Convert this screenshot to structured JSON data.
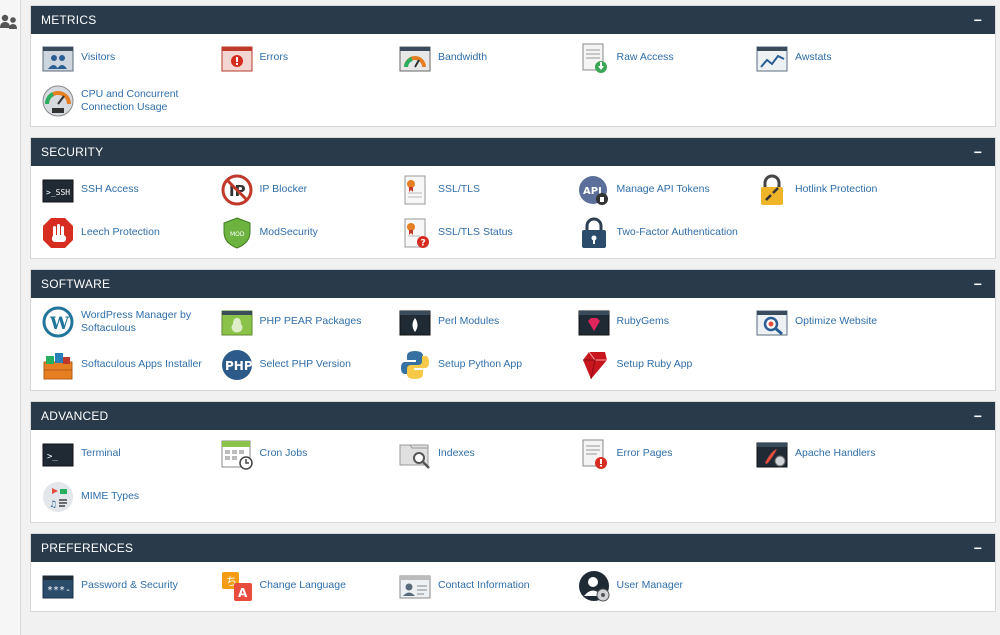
{
  "colors": {
    "header": "#293a4a",
    "link": "#2f6ea9",
    "bg": "#f1f1f1"
  },
  "panels": [
    {
      "title": "METRICS",
      "toggle": "−",
      "items": [
        {
          "label": "Visitors",
          "icon": "visitors-icon"
        },
        {
          "label": "Errors",
          "icon": "errors-icon"
        },
        {
          "label": "Bandwidth",
          "icon": "bandwidth-icon"
        },
        {
          "label": "Raw Access",
          "icon": "raw-access-icon"
        },
        {
          "label": "Awstats",
          "icon": "awstats-icon"
        },
        {
          "label": "CPU and Concurrent Connection Usage",
          "icon": "cpu-usage-icon"
        }
      ]
    },
    {
      "title": "SECURITY",
      "toggle": "−",
      "items": [
        {
          "label": "SSH Access",
          "icon": "ssh-icon"
        },
        {
          "label": "IP Blocker",
          "icon": "ip-blocker-icon"
        },
        {
          "label": "SSL/TLS",
          "icon": "ssl-certificate-icon"
        },
        {
          "label": "Manage API Tokens",
          "icon": "api-tokens-icon"
        },
        {
          "label": "Hotlink Protection",
          "icon": "hotlink-lock-icon"
        },
        {
          "label": "Leech Protection",
          "icon": "leech-hand-icon"
        },
        {
          "label": "ModSecurity",
          "icon": "modsecurity-shield-icon"
        },
        {
          "label": "SSL/TLS Status",
          "icon": "ssl-status-icon"
        },
        {
          "label": "Two-Factor Authentication",
          "icon": "two-factor-lock-icon"
        }
      ]
    },
    {
      "title": "SOFTWARE",
      "toggle": "−",
      "items": [
        {
          "label": "WordPress Manager by Softaculous",
          "icon": "wordpress-icon"
        },
        {
          "label": "PHP PEAR Packages",
          "icon": "php-pear-icon"
        },
        {
          "label": "Perl Modules",
          "icon": "perl-icon"
        },
        {
          "label": "RubyGems",
          "icon": "rubygems-icon"
        },
        {
          "label": "Optimize Website",
          "icon": "optimize-icon"
        },
        {
          "label": "Softaculous Apps Installer",
          "icon": "softaculous-icon"
        },
        {
          "label": "Select PHP Version",
          "icon": "php-icon"
        },
        {
          "label": "Setup Python App",
          "icon": "python-icon"
        },
        {
          "label": "Setup Ruby App",
          "icon": "ruby-icon"
        }
      ]
    },
    {
      "title": "ADVANCED",
      "toggle": "−",
      "items": [
        {
          "label": "Terminal",
          "icon": "terminal-icon"
        },
        {
          "label": "Cron Jobs",
          "icon": "cron-calendar-icon"
        },
        {
          "label": "Indexes",
          "icon": "indexes-icon"
        },
        {
          "label": "Error Pages",
          "icon": "error-pages-icon"
        },
        {
          "label": "Apache Handlers",
          "icon": "apache-handlers-icon"
        },
        {
          "label": "MIME Types",
          "icon": "mime-types-icon"
        }
      ]
    },
    {
      "title": "PREFERENCES",
      "toggle": "−",
      "items": [
        {
          "label": "Password & Security",
          "icon": "password-icon"
        },
        {
          "label": "Change Language",
          "icon": "language-icon"
        },
        {
          "label": "Contact Information",
          "icon": "contact-card-icon"
        },
        {
          "label": "User Manager",
          "icon": "user-manager-icon"
        }
      ]
    }
  ]
}
